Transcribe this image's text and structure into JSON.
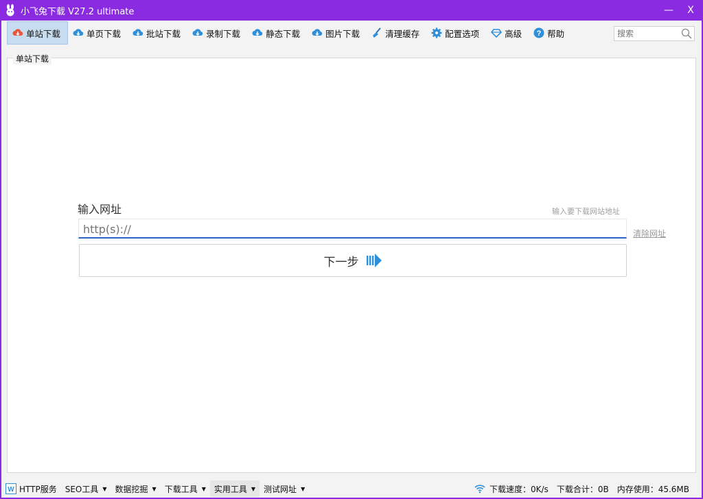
{
  "window": {
    "title": "小飞兔下载 V27.2 ultimate",
    "minimize": "—",
    "close": "X"
  },
  "toolbar": {
    "items": [
      {
        "label": "单站下载",
        "icon": "cloud-download-icon",
        "active": true
      },
      {
        "label": "单页下载",
        "icon": "cloud-download-icon"
      },
      {
        "label": "批站下载",
        "icon": "cloud-download-icon"
      },
      {
        "label": "录制下载",
        "icon": "cloud-download-icon"
      },
      {
        "label": "静态下载",
        "icon": "cloud-download-icon"
      },
      {
        "label": "图片下载",
        "icon": "cloud-download-icon"
      },
      {
        "label": "清理缓存",
        "icon": "broom-icon"
      },
      {
        "label": "配置选项",
        "icon": "gear-icon"
      },
      {
        "label": "高级",
        "icon": "diamond-icon"
      },
      {
        "label": "帮助",
        "icon": "help-icon"
      }
    ],
    "search_placeholder": "搜索"
  },
  "panel": {
    "legend": "单站下载",
    "url_label": "输入网址",
    "url_hint": "输入要下载网站地址",
    "url_placeholder": "http(s)://",
    "clear_label": "清除网址",
    "next_label": "下一步"
  },
  "statusbar": {
    "items": [
      {
        "label": "HTTP服务",
        "icon": "w-icon",
        "caret": false
      },
      {
        "label": "SEO工具",
        "caret": true
      },
      {
        "label": "数据挖掘",
        "caret": true
      },
      {
        "label": "下载工具",
        "caret": true
      },
      {
        "label": "实用工具",
        "caret": true
      },
      {
        "label": "测试网址",
        "caret": true
      }
    ],
    "speed": "下载速度：0K/s",
    "total": "下载合计：0B",
    "memory": "内存使用：45.6MB"
  },
  "colors": {
    "titlebar": "#8a2be2",
    "accent": "#2b64c5",
    "active_tab": "#c8dcf0"
  }
}
